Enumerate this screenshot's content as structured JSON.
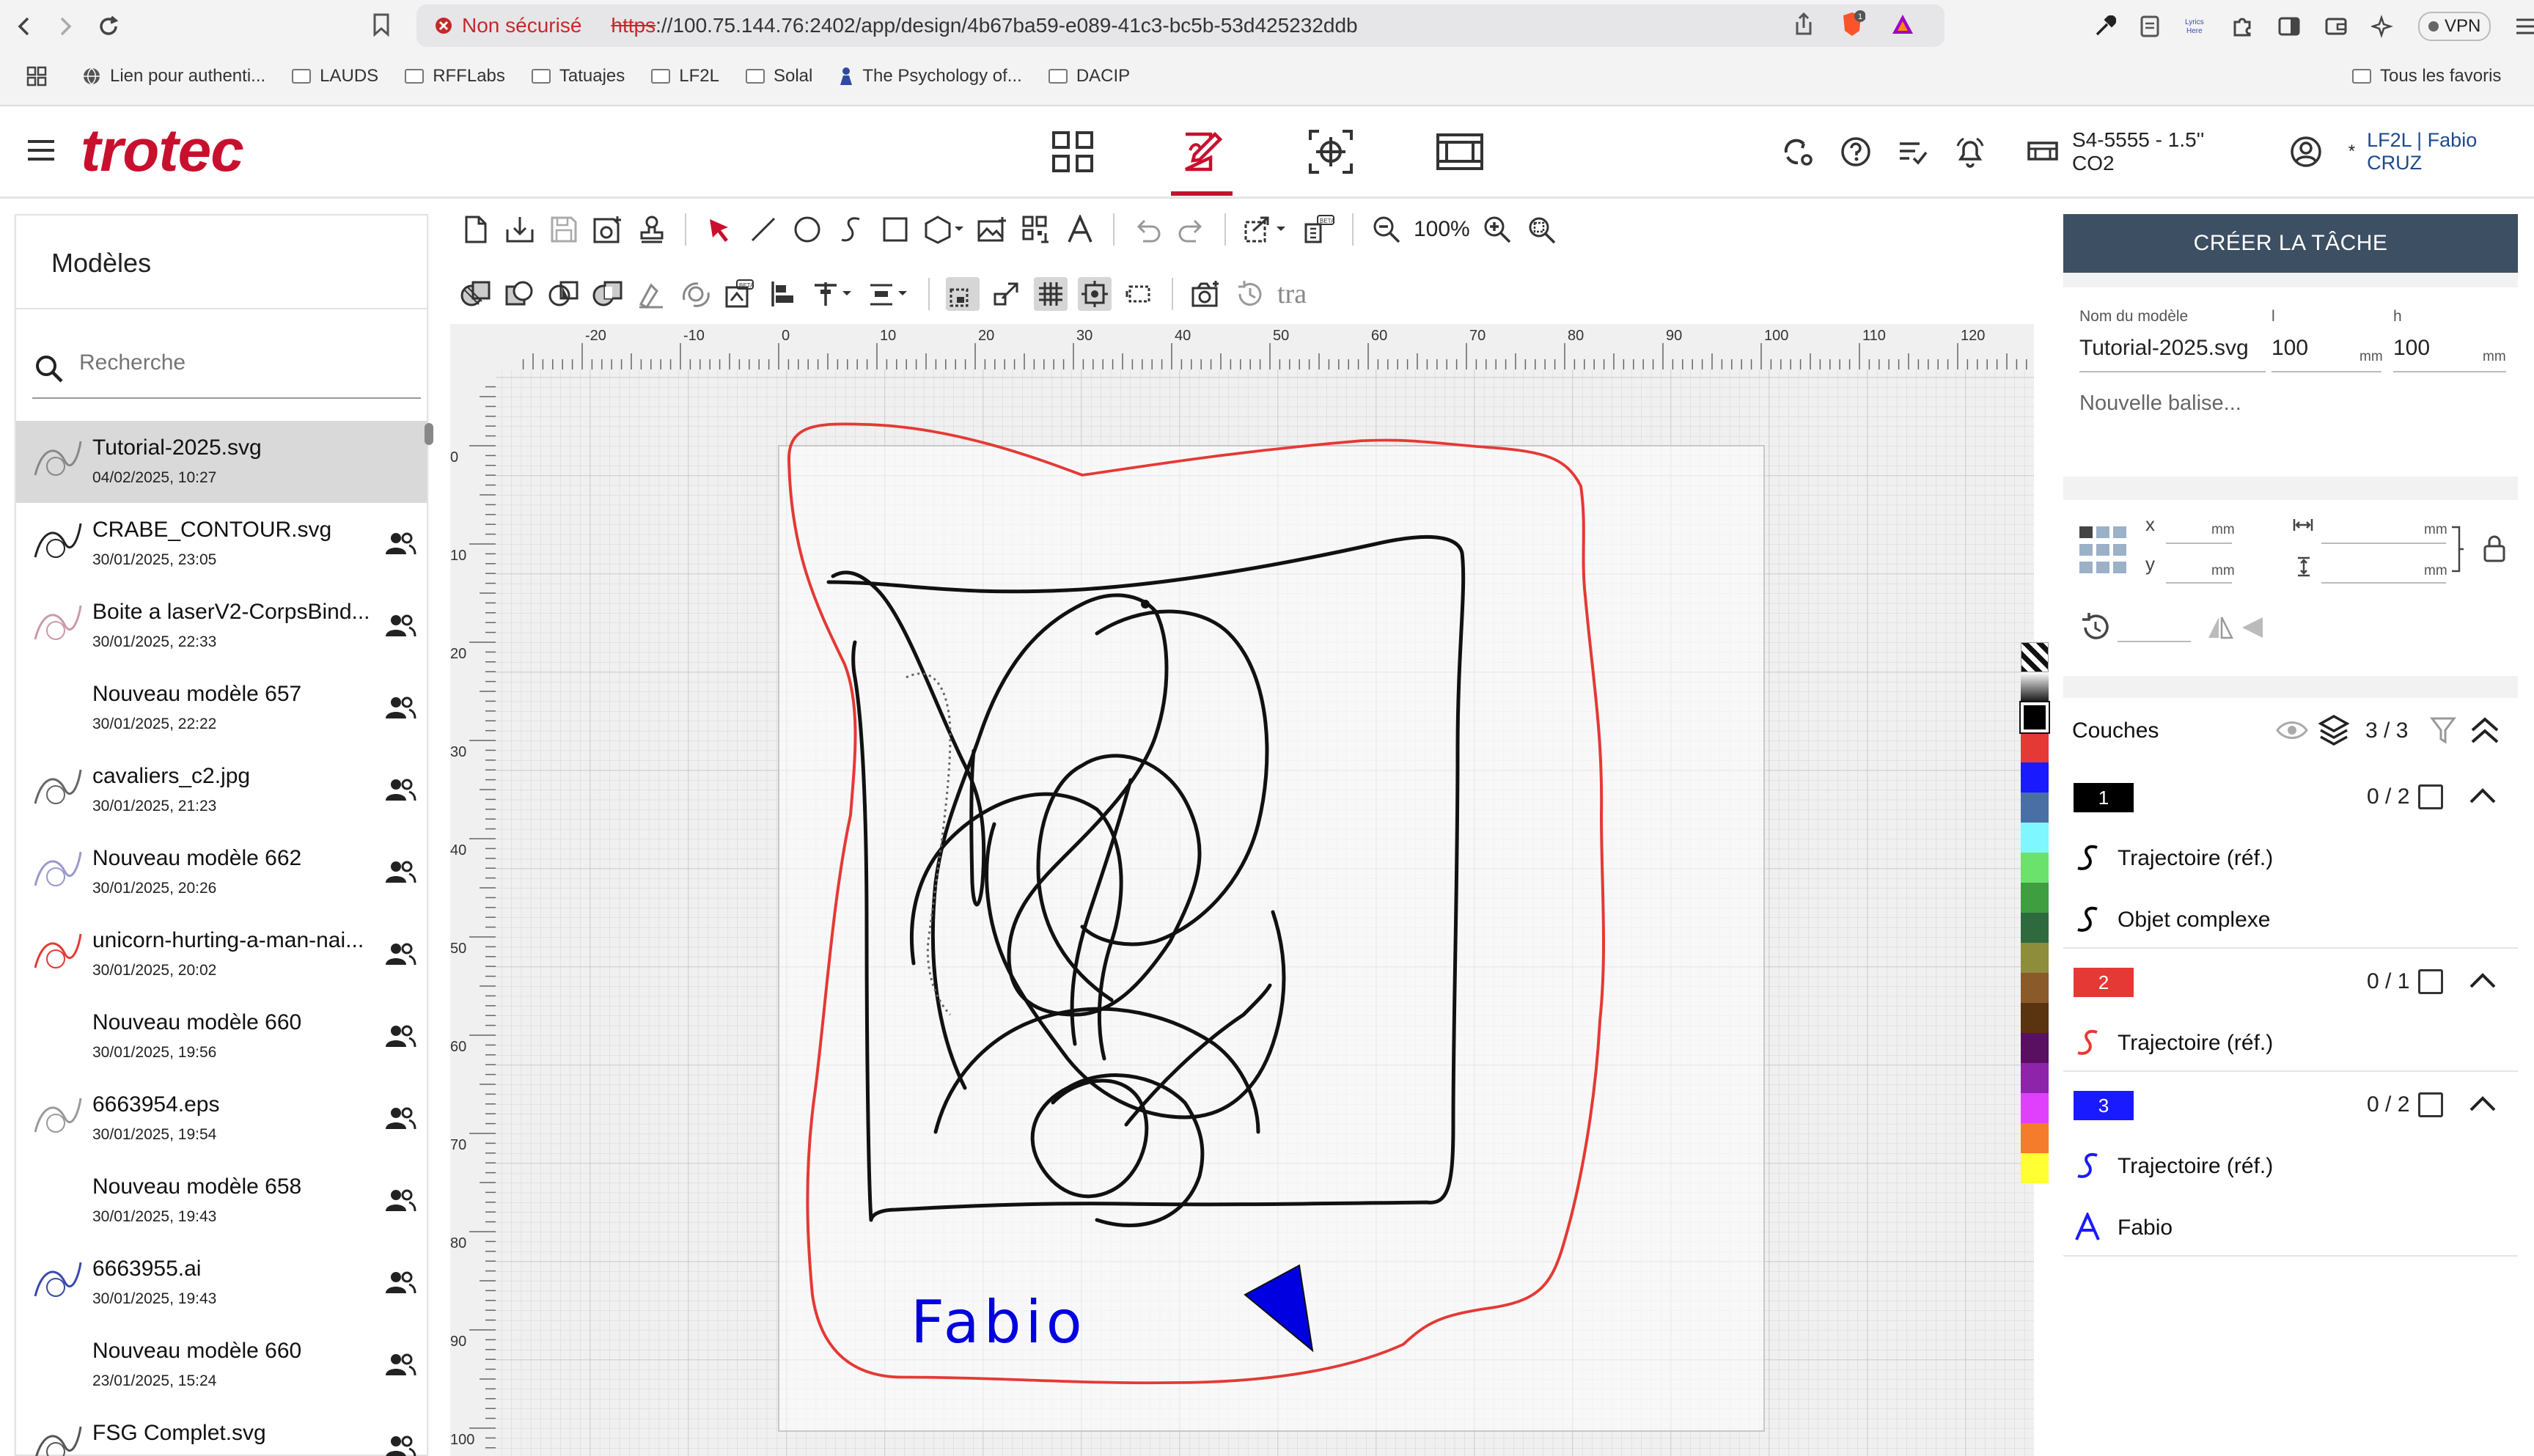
{
  "browser": {
    "security_label": "Non sécurisé",
    "url_scheme": "https",
    "url_rest": "://100.75.144.76:2402/app/design/4b67ba59-e089-41c3-bc5b-53d425232ddb",
    "vpn_label": "VPN",
    "bookmarks": [
      "Lien pour authenti...",
      "LAUDS",
      "RFFLabs",
      "Tatuajes",
      "LF2L",
      "Solal",
      "The Psychology of...",
      "DACIP"
    ],
    "all_bookmarks": "Tous les favoris"
  },
  "app": {
    "logo": "trotec",
    "machine": "S4-5555 - 1.5'' CO2",
    "user": "LF2L | Fabio CRUZ",
    "user_prefix": "*"
  },
  "left_panel": {
    "title": "Modèles",
    "search_placeholder": "Recherche",
    "items": [
      {
        "name": "Tutorial-2025.svg",
        "date": "04/02/2025, 10:27",
        "selected": true,
        "shared": false
      },
      {
        "name": "CRABE_CONTOUR.svg",
        "date": "30/01/2025, 23:05",
        "shared": true
      },
      {
        "name": "Boite a laserV2-CorpsBind...",
        "date": "30/01/2025, 22:33",
        "shared": true
      },
      {
        "name": "Nouveau modèle 657",
        "date": "30/01/2025, 22:22",
        "shared": true
      },
      {
        "name": "cavaliers_c2.jpg",
        "date": "30/01/2025, 21:23",
        "shared": true
      },
      {
        "name": "Nouveau modèle 662",
        "date": "30/01/2025, 20:26",
        "shared": true
      },
      {
        "name": "unicorn-hurting-a-man-nai...",
        "date": "30/01/2025, 20:02",
        "shared": true
      },
      {
        "name": "Nouveau modèle 660",
        "date": "30/01/2025, 19:56",
        "shared": true
      },
      {
        "name": "6663954.eps",
        "date": "30/01/2025, 19:54",
        "shared": true
      },
      {
        "name": "Nouveau modèle 658",
        "date": "30/01/2025, 19:43",
        "shared": true
      },
      {
        "name": "6663955.ai",
        "date": "30/01/2025, 19:43",
        "shared": true
      },
      {
        "name": "Nouveau modèle 660",
        "date": "23/01/2025, 15:24",
        "shared": true
      },
      {
        "name": "FSG Complet.svg",
        "date": "",
        "shared": true
      }
    ]
  },
  "toolbar": {
    "zoom": "100%",
    "tra_label": "tra"
  },
  "ruler": {
    "top_labels": [
      "-20",
      "-10",
      "0",
      "10",
      "20",
      "30",
      "40",
      "50",
      "60",
      "70",
      "80",
      "90",
      "100",
      "110",
      "120"
    ],
    "left_labels": [
      "0",
      "10",
      "20",
      "30",
      "40",
      "50",
      "60",
      "70",
      "80",
      "90",
      "100"
    ]
  },
  "canvas": {
    "text_object": "Fabio",
    "outline_color": "#e53935",
    "text_color": "#0000e0"
  },
  "colors": [
    "#000000",
    "#e53935",
    "#1a1aff",
    "#4a6fa5",
    "#7ff7ff",
    "#6be26b",
    "#3f9e3f",
    "#2e6a3d",
    "#8d8d3b",
    "#8a5a2b",
    "#5a3310",
    "#5a1060",
    "#8e24aa",
    "#e040fb",
    "#f57c2a",
    "#ffff33"
  ],
  "right_panel": {
    "create_button": "CRÉER LA TÂCHE",
    "model_name_label": "Nom du modèle",
    "model_name": "Tutorial-2025.svg",
    "width_label": "l",
    "width_value": "100",
    "height_label": "h",
    "height_value": "100",
    "unit": "mm",
    "tag_placeholder": "Nouvelle balise...",
    "x_label": "x",
    "y_label": "y",
    "layers_title": "Couches",
    "layers_count": "3 / 3",
    "layers": [
      {
        "number": "1",
        "color": "#000000",
        "count": "0 / 2",
        "objects": [
          {
            "label": "Trajectoire (réf.)",
            "icon": "path-icon"
          },
          {
            "label": "Objet complexe",
            "icon": "path-icon"
          }
        ]
      },
      {
        "number": "2",
        "color": "#e53935",
        "count": "0 / 1",
        "objects": [
          {
            "label": "Trajectoire (réf.)",
            "icon": "path-icon"
          }
        ]
      },
      {
        "number": "3",
        "color": "#1a1aff",
        "count": "0 / 2",
        "objects": [
          {
            "label": "Trajectoire (réf.)",
            "icon": "path-icon"
          },
          {
            "label": "Fabio",
            "icon": "text-icon"
          }
        ]
      }
    ]
  }
}
